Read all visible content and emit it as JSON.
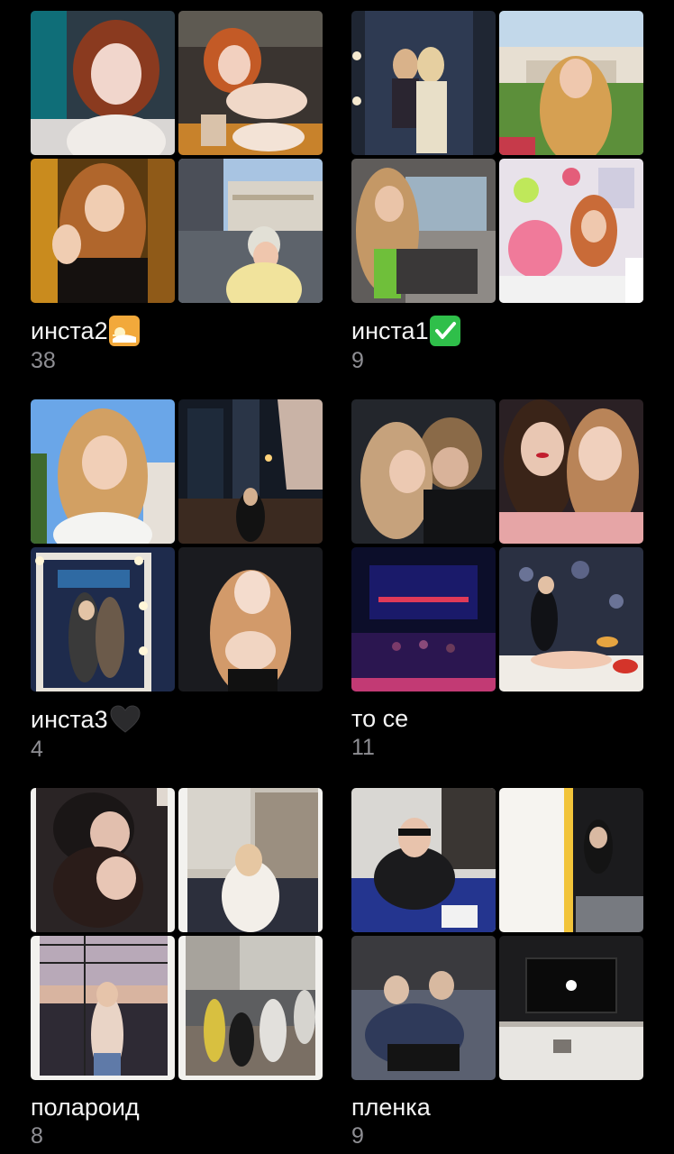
{
  "albums": [
    {
      "title": "инста2",
      "emoji": "sunrise-emoji",
      "count": "38",
      "thumbs": [
        "portrait-redhead-selfie",
        "redhead-cafe-dessert",
        "waving-girl-night-street",
        "girl-city-building-day"
      ]
    },
    {
      "title": "инста1",
      "emoji": "check-mark-emoji",
      "count": "9",
      "thumbs": [
        "mirror-selfie-two-girls",
        "blonde-park-fountain",
        "girl-car-interior",
        "girl-pink-mask-room"
      ]
    },
    {
      "title": "инста3",
      "emoji": "black-heart-emoji",
      "count": "4",
      "thumbs": [
        "blonde-selfie-blue-sky",
        "girl-night-skyscrapers",
        "mirror-lights-group",
        "redhead-dark-flash"
      ]
    },
    {
      "title": "то се",
      "emoji": "",
      "count": "11",
      "thumbs": [
        "couple-dark-selfie",
        "two-girls-selfie",
        "club-crowd-stage",
        "party-floor-room"
      ]
    },
    {
      "title": "полароид",
      "emoji": "",
      "count": "8",
      "thumbs": [
        "polaroid-two-girls",
        "polaroid-girl-street",
        "polaroid-girl-rooftop",
        "polaroid-group-street"
      ]
    },
    {
      "title": "пленка",
      "emoji": "",
      "count": "9",
      "thumbs": [
        "guy-blue-chair",
        "dj-booth-film",
        "guys-couch-film",
        "tv-room-film"
      ]
    }
  ]
}
